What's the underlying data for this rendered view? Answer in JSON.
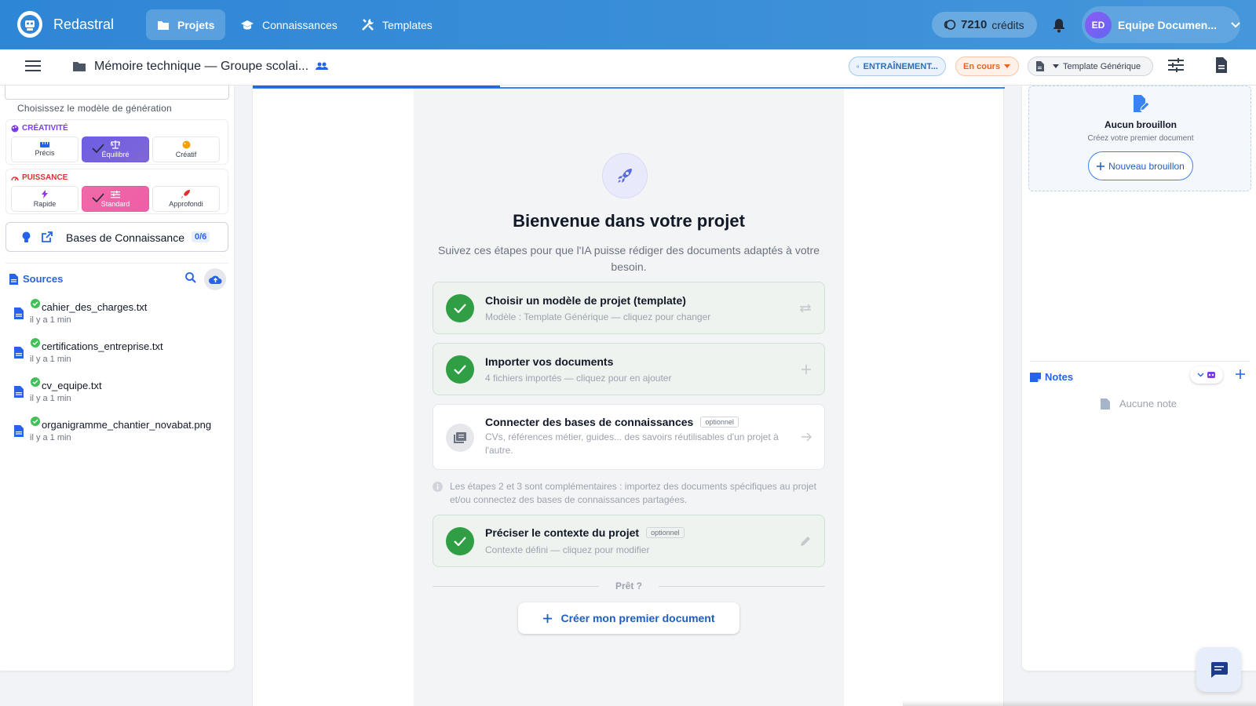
{
  "header": {
    "brand": "Redastral",
    "nav": [
      {
        "label": "Projets",
        "icon": "folder-icon",
        "active": true
      },
      {
        "label": "Connaissances",
        "icon": "graduation-cap-icon",
        "active": false
      },
      {
        "label": "Templates",
        "icon": "tools-icon",
        "active": false
      }
    ],
    "credits_value": "7210",
    "credits_label": "crédits",
    "user_initials": "ED",
    "user_name": "Equipe Documen..."
  },
  "subbar": {
    "project_title": "Mémoire technique — Groupe scolai...",
    "training_label": "ENTRAÎNEMENT...",
    "status_label": "En cours",
    "template_label": "Template Générique"
  },
  "left": {
    "model_label": "Choisissez le modèle de génération",
    "creativity": {
      "heading": "CRÉATIVITÉ",
      "options": [
        "Précis",
        "Équilibré",
        "Créatif"
      ]
    },
    "power": {
      "heading": "PUISSANCE",
      "options": [
        "Rapide",
        "Standard",
        "Approfondi"
      ]
    },
    "kb_label": "Bases de Connaissance",
    "kb_count": "0/6",
    "sources_heading": "Sources",
    "files": [
      {
        "name": "cahier_des_charges.txt",
        "time": "il y a 1 min"
      },
      {
        "name": "certifications_entreprise.txt",
        "time": "il y a 1 min"
      },
      {
        "name": "cv_equipe.txt",
        "time": "il y a 1 min"
      },
      {
        "name": "organigramme_chantier_novabat.png",
        "time": "il y a 1 min"
      }
    ]
  },
  "main": {
    "welcome_title": "Bienvenue dans votre projet",
    "welcome_sub": "Suivez ces étapes pour que l'IA puisse rédiger des documents adaptés à votre besoin.",
    "steps": [
      {
        "title": "Choisir un modèle de projet (template)",
        "desc": "Modèle : Template Générique — cliquez pour changer",
        "optional": ""
      },
      {
        "title": "Importer vos documents",
        "desc": "4 fichiers importés — cliquez pour en ajouter",
        "optional": ""
      },
      {
        "title": "Connecter des bases de connaissances",
        "desc": "CVs, références métier, guides... des savoirs réutilisables d'un projet à l'autre.",
        "optional": "optionnel"
      },
      {
        "title": "Préciser le contexte du projet",
        "desc": "Contexte défini — cliquez pour modifier",
        "optional": "optionnel"
      }
    ],
    "info_text": "Les étapes 2 et 3 sont complémentaires : importez des documents spécifiques au projet et/ou connectez des bases de connaissances partagées.",
    "ready_label": "Prêt ?",
    "cta_label": "Créer mon premier document"
  },
  "right": {
    "draft_title": "Aucun brouillon",
    "draft_sub": "Créez votre premier document",
    "draft_button": "Nouveau brouillon",
    "notes_heading": "Notes",
    "no_note": "Aucune note"
  },
  "colors": {
    "primary": "#2e86d6",
    "success": "#2f9e44",
    "creativity_accent": "#7c3aed",
    "power_accent": "#e03131"
  }
}
